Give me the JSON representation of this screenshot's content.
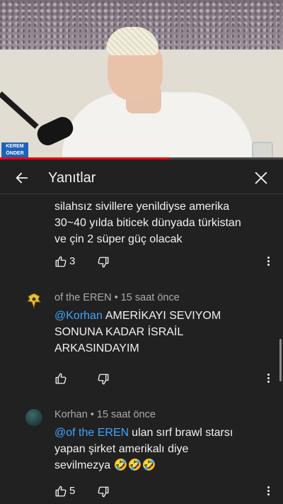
{
  "video": {
    "badge_line1": "KEREM",
    "badge_line2": "ÖNDER",
    "progress_fraction": 0.6
  },
  "header": {
    "title": "Yanıtlar",
    "back_icon": "arrow-left-icon",
    "close_icon": "close-icon"
  },
  "comments": [
    {
      "text_lines": [
        "silahsız sivillere yenildiyse amerika",
        "30~40 yılda biticek dünyada türkistan",
        "ve çin 2 süper güç olacak"
      ],
      "likes": "3"
    },
    {
      "author": "of the EREN",
      "time": "• 15 saat önce",
      "mention": "@Korhan",
      "text_lines": [
        "AMERİKAYI SEVIYOM",
        "SONUNA KADAR İSRAİL",
        "ARKASINDAYIM"
      ],
      "likes": ""
    },
    {
      "author": "Korhan",
      "time": "• 15 saat önce",
      "mention": "@of the EREN",
      "text_lines": [
        "ulan sırf brawl starsı",
        "yapan şirket amerikalı diye",
        "sevilmezya"
      ],
      "emojis": "🤣🤣🤣",
      "likes": "5"
    }
  ]
}
